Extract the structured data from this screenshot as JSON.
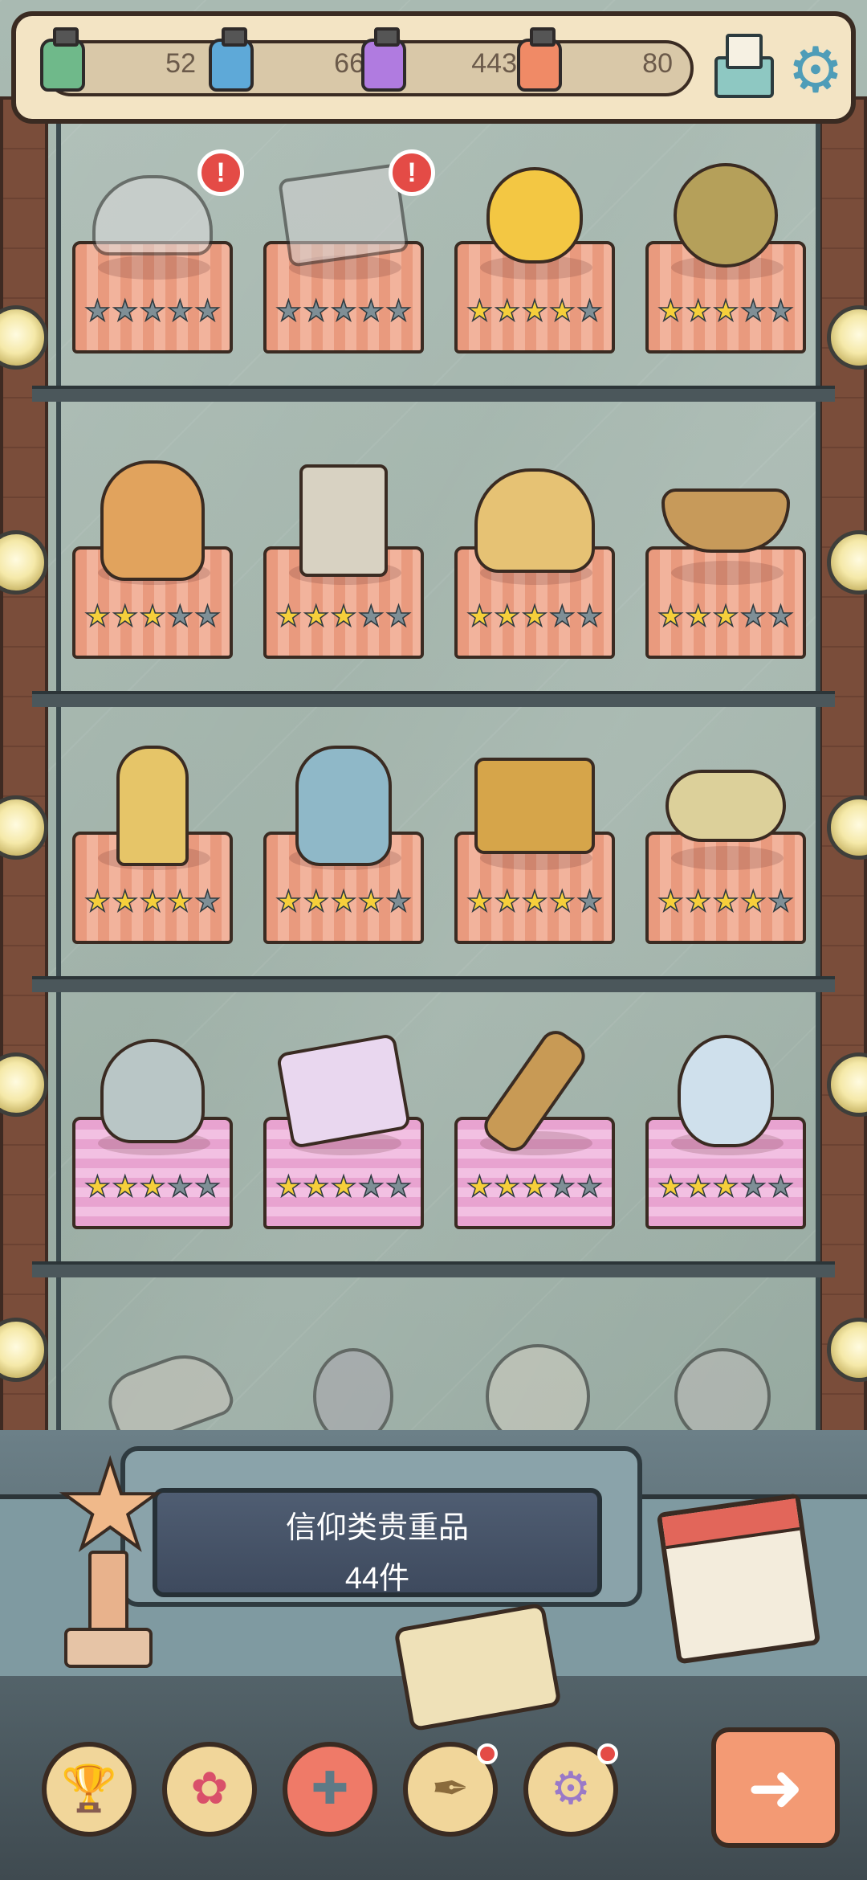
{
  "resources": [
    {
      "icon": "green-jar-icon",
      "color": "#6fb98a",
      "value": "52"
    },
    {
      "icon": "blue-jar-icon",
      "color": "#5ea9d8",
      "value": "66"
    },
    {
      "icon": "purple-jar-icon",
      "color": "#b07be0",
      "value": "443"
    },
    {
      "icon": "orange-jar-icon",
      "color": "#f08a66",
      "value": "80"
    }
  ],
  "header": {
    "mail_icon": "mail-icon",
    "settings_icon": "gear-icon"
  },
  "shelves": [
    {
      "items": [
        {
          "name": "peacock-fan",
          "stars": 0,
          "max": 5,
          "alert": "!",
          "locked": true
        },
        {
          "name": "old-scroll",
          "stars": 0,
          "max": 5,
          "alert": "!",
          "locked": true
        },
        {
          "name": "golden-apple",
          "stars": 4,
          "max": 5,
          "alert": "",
          "locked": false
        },
        {
          "name": "bronze-eye-relic",
          "stars": 3,
          "max": 5,
          "alert": "",
          "locked": false
        }
      ]
    },
    {
      "items": [
        {
          "name": "three-faced-bust",
          "stars": 3,
          "max": 5
        },
        {
          "name": "shroud-tablet",
          "stars": 3,
          "max": 5
        },
        {
          "name": "bread-basket",
          "stars": 3,
          "max": 5
        },
        {
          "name": "wooden-boat",
          "stars": 3,
          "max": 5
        }
      ]
    },
    {
      "items": [
        {
          "name": "pointing-hand-statue",
          "stars": 4,
          "max": 5
        },
        {
          "name": "bearded-sage",
          "stars": 4,
          "max": 5
        },
        {
          "name": "golden-ark",
          "stars": 4,
          "max": 5
        },
        {
          "name": "auspicious-cloud",
          "stars": 4,
          "max": 5
        }
      ]
    },
    {
      "items": [
        {
          "name": "silver-lamp",
          "stars": 3,
          "max": 5
        },
        {
          "name": "thorned-tome",
          "stars": 3,
          "max": 5
        },
        {
          "name": "flame-torch",
          "stars": 3,
          "max": 5
        },
        {
          "name": "holy-water-flask",
          "stars": 3,
          "max": 5
        }
      ]
    }
  ],
  "partial_shelf": [
    "golden-sandal",
    "jeweled-mirror",
    "winged-coin",
    "spinning-wheel"
  ],
  "plaque": {
    "title": "信仰类贵重品",
    "count": "44件"
  },
  "nav": [
    {
      "icon": "trophy-icon",
      "glyph": "🏆",
      "active": false,
      "dot": false
    },
    {
      "icon": "rose-icon",
      "glyph": "✿",
      "active": false,
      "dot": false
    },
    {
      "icon": "cross-icon",
      "glyph": "✚",
      "active": true,
      "dot": false
    },
    {
      "icon": "feather-icon",
      "glyph": "✒",
      "active": false,
      "dot": true
    },
    {
      "icon": "cog-icon",
      "glyph": "⚙",
      "active": false,
      "dot": true
    }
  ],
  "next": {
    "icon": "arrow-right-icon",
    "glyph": "➜"
  }
}
